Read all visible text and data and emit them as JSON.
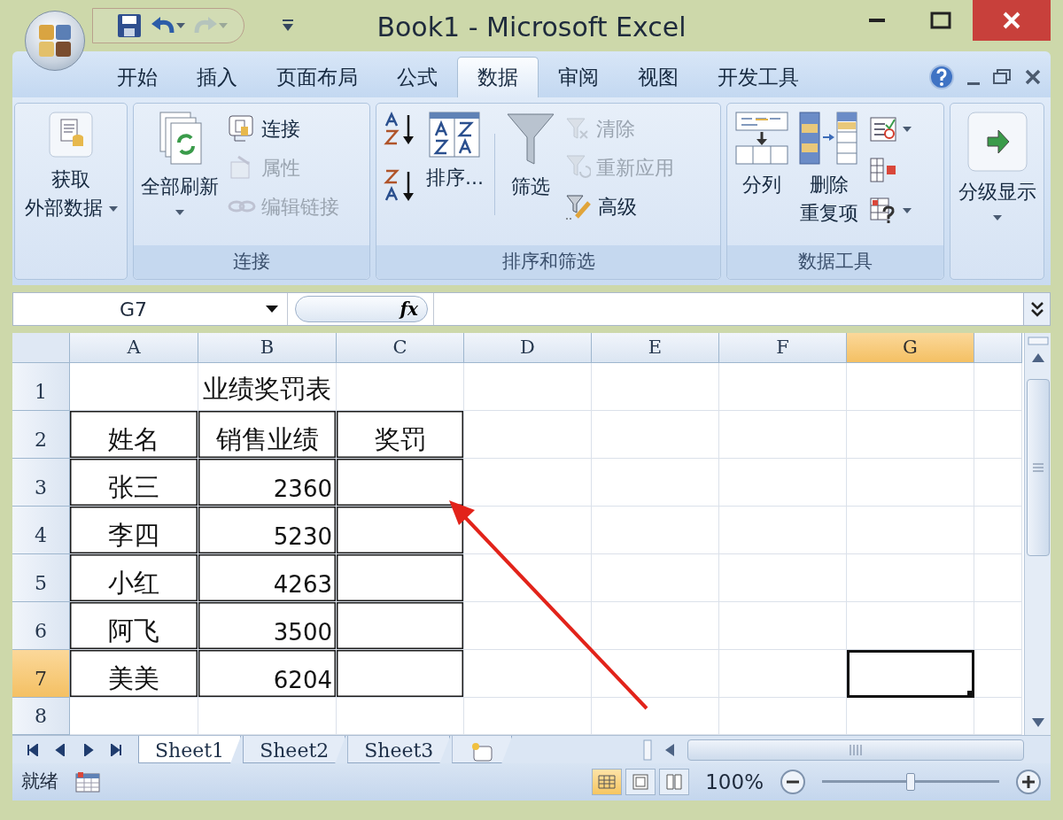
{
  "window": {
    "title": "Book1 - Microsoft Excel"
  },
  "quick_access": [
    {
      "kind": "save",
      "disabled": false
    },
    {
      "kind": "undo",
      "disabled": false
    },
    {
      "kind": "redo",
      "disabled": true
    }
  ],
  "ribbon_tabs": [
    {
      "label": "开始",
      "selected": false
    },
    {
      "label": "插入",
      "selected": false
    },
    {
      "label": "页面布局",
      "selected": false
    },
    {
      "label": "公式",
      "selected": false
    },
    {
      "label": "数据",
      "selected": true
    },
    {
      "label": "审阅",
      "selected": false
    },
    {
      "label": "视图",
      "selected": false
    },
    {
      "label": "开发工具",
      "selected": false
    }
  ],
  "ribbon_groups": [
    {
      "buttons": [
        {
          "kind": "large",
          "lines": [
            "获取",
            "外部数据"
          ],
          "dropdown": true,
          "disabled": false
        }
      ]
    },
    {
      "label": "连接",
      "buttons": [
        {
          "kind": "large",
          "lines": [
            "全部刷新"
          ],
          "dropdown": true,
          "disabled": false
        },
        {
          "kind": "small",
          "label": "连接",
          "disabled": false
        },
        {
          "kind": "small",
          "label": "属性",
          "disabled": true
        },
        {
          "kind": "small",
          "label": "编辑链接",
          "disabled": true
        }
      ]
    },
    {
      "label": "排序和筛选",
      "buttons": [
        {
          "kind": "icon",
          "dropdown": false,
          "disabled": false
        },
        {
          "kind": "icon",
          "dropdown": false,
          "disabled": false
        },
        {
          "kind": "large",
          "lines": [
            "排序..."
          ],
          "dropdown": false,
          "disabled": false
        },
        {
          "kind": "large",
          "lines": [
            "筛选"
          ],
          "dropdown": false,
          "disabled": false
        },
        {
          "kind": "small",
          "label": "清除",
          "disabled": true
        },
        {
          "kind": "small",
          "label": "重新应用",
          "disabled": true
        },
        {
          "kind": "small",
          "label": "高级",
          "disabled": false
        }
      ]
    },
    {
      "label": "数据工具",
      "buttons": [
        {
          "kind": "large",
          "lines": [
            "分列"
          ],
          "dropdown": false,
          "disabled": false
        },
        {
          "kind": "large",
          "lines": [
            "删除",
            "重复项"
          ],
          "dropdown": false,
          "disabled": false
        },
        {
          "kind": "icon",
          "dropdown": true,
          "disabled": false
        },
        {
          "kind": "icon",
          "dropdown": false,
          "disabled": false
        },
        {
          "kind": "icon",
          "dropdown": true,
          "disabled": false
        }
      ]
    },
    {
      "buttons": [
        {
          "kind": "large",
          "lines": [
            "分级显示"
          ],
          "dropdown": true,
          "disabled": false
        }
      ]
    }
  ],
  "formula_bar": {
    "name_box": "G7",
    "fx": "fx"
  },
  "sheet": {
    "columns": [
      {
        "label": "A",
        "selected": false
      },
      {
        "label": "B",
        "selected": false
      },
      {
        "label": "C",
        "selected": false
      },
      {
        "label": "D",
        "selected": false
      },
      {
        "label": "E",
        "selected": false
      },
      {
        "label": "F",
        "selected": false
      },
      {
        "label": "G",
        "selected": true
      }
    ],
    "rows": [
      {
        "label": "1",
        "selected": false,
        "cells": [
          {
            "text": "",
            "kind": "text",
            "bordered": false
          },
          {
            "text": "业绩奖罚表",
            "kind": "title",
            "bordered": false
          },
          {
            "text": "",
            "kind": "text",
            "bordered": false
          }
        ]
      },
      {
        "label": "2",
        "selected": false,
        "cells": [
          {
            "text": "姓名",
            "kind": "text",
            "bordered": true
          },
          {
            "text": "销售业绩",
            "kind": "text",
            "bordered": true
          },
          {
            "text": "奖罚",
            "kind": "text",
            "bordered": true
          }
        ]
      },
      {
        "label": "3",
        "selected": false,
        "cells": [
          {
            "text": "张三",
            "kind": "text",
            "bordered": true
          },
          {
            "text": "2360",
            "kind": "number",
            "bordered": true
          },
          {
            "text": "",
            "kind": "text",
            "bordered": true
          }
        ]
      },
      {
        "label": "4",
        "selected": false,
        "cells": [
          {
            "text": "李四",
            "kind": "text",
            "bordered": true
          },
          {
            "text": "5230",
            "kind": "number",
            "bordered": true
          },
          {
            "text": "",
            "kind": "text",
            "bordered": true
          }
        ]
      },
      {
        "label": "5",
        "selected": false,
        "cells": [
          {
            "text": "小红",
            "kind": "text",
            "bordered": true
          },
          {
            "text": "4263",
            "kind": "number",
            "bordered": true
          },
          {
            "text": "",
            "kind": "text",
            "bordered": true
          }
        ]
      },
      {
        "label": "6",
        "selected": false,
        "cells": [
          {
            "text": "阿飞",
            "kind": "text",
            "bordered": true
          },
          {
            "text": "3500",
            "kind": "number",
            "bordered": true
          },
          {
            "text": "",
            "kind": "text",
            "bordered": true
          }
        ]
      },
      {
        "label": "7",
        "selected": true,
        "cells": [
          {
            "text": "美美",
            "kind": "text",
            "bordered": true
          },
          {
            "text": "6204",
            "kind": "number",
            "bordered": true
          },
          {
            "text": "",
            "kind": "text",
            "bordered": true
          }
        ]
      },
      {
        "label": "8",
        "selected": false,
        "cells": []
      }
    ]
  },
  "sheet_tabs": [
    {
      "label": "Sheet1",
      "selected": true
    },
    {
      "label": "Sheet2",
      "selected": false
    },
    {
      "label": "Sheet3",
      "selected": false
    }
  ],
  "status_bar": {
    "text": "就绪",
    "views": [
      {
        "selected": true
      },
      {
        "selected": false
      },
      {
        "selected": false
      }
    ],
    "zoom": "100%",
    "zoom_slider": {
      "level": 0.5
    }
  }
}
